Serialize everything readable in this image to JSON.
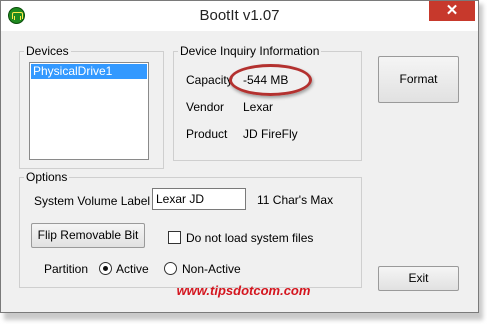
{
  "window": {
    "title": "BootIt v1.07",
    "close_glyph": "✕"
  },
  "devices": {
    "legend": "Devices",
    "items": [
      "PhysicalDrive1"
    ]
  },
  "inquiry": {
    "legend": "Device Inquiry Information",
    "capacity_label": "Capacity",
    "capacity_value": "-544 MB",
    "vendor_label": "Vendor",
    "vendor_value": "Lexar",
    "product_label": "Product",
    "product_value": "JD FireFly"
  },
  "buttons": {
    "format": "Format",
    "exit": "Exit"
  },
  "options": {
    "legend": "Options",
    "volume_label": "System Volume Label",
    "volume_value": "Lexar JD",
    "char_limit": "11 Char's Max",
    "flip_button": "Flip Removable Bit",
    "no_load_label": "Do not load system files",
    "no_load_checked": false,
    "partition_label": "Partition",
    "partition_active": "Active",
    "partition_nonactive": "Non-Active",
    "partition_selected": "Active"
  },
  "watermark": "www.tipsdotcom.com",
  "colors": {
    "accent_select": "#3399ff",
    "close": "#c7392c",
    "highlight": "#b3312f",
    "watermark": "#d4151e"
  }
}
